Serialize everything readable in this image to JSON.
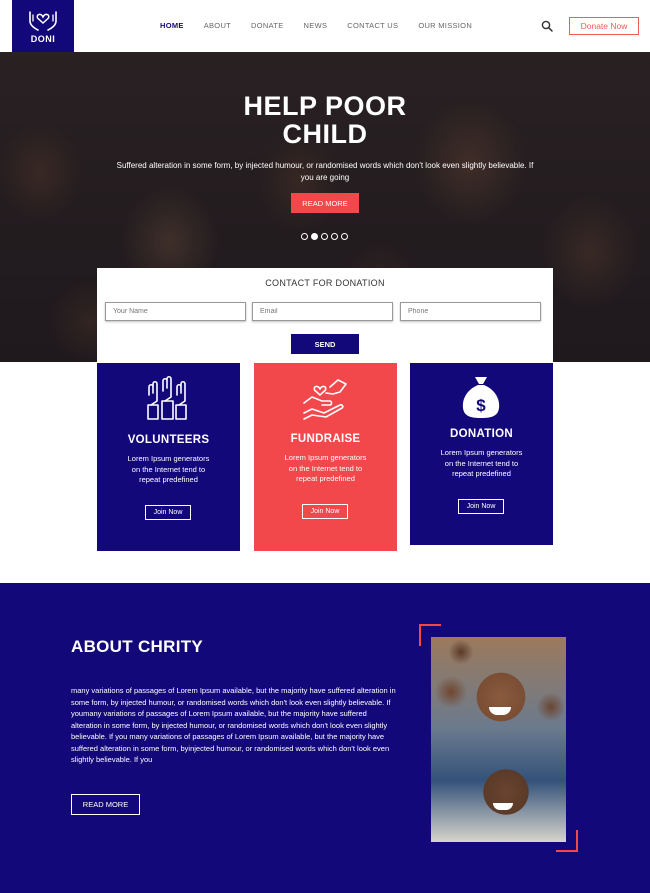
{
  "brand": {
    "name": "DONI"
  },
  "nav": {
    "items": [
      "HOME",
      "ABOUT",
      "DONATE",
      "NEWS",
      "CONTACT US",
      "OUR MISSION"
    ],
    "active": "HOME",
    "donate_label": "Donate Now"
  },
  "hero": {
    "title_line1": "HELP POOR",
    "title_line2": "CHILD",
    "text": "Suffered alteration in some form, by injected humour, or randomised words which don't look even slightly believable. If you are going",
    "button": "READ MORE",
    "slides": 5,
    "active_slide": 2
  },
  "contact": {
    "title": "CONTACT FOR DONATION",
    "name_placeholder": "Your Name",
    "email_placeholder": "Email",
    "phone_placeholder": "Phone",
    "send_label": "SEND"
  },
  "cards": [
    {
      "title": "VOLUNTEERS",
      "text": "Lorem Ipsum generators on the Internet tend to repeat predefined",
      "button": "Join Now",
      "color": "#12087a"
    },
    {
      "title": "FUNDRAISE",
      "text": "Lorem Ipsum generators on the Internet tend to repeat predefined",
      "button": "Join Now",
      "color": "#f2474b"
    },
    {
      "title": "DONATION",
      "text": "Lorem Ipsum generators on the Internet tend to repeat predefined",
      "button": "Join Now",
      "color": "#12087a"
    }
  ],
  "about": {
    "title": "ABOUT CHRITY",
    "text": "many variations of passages of Lorem Ipsum available, but the majority have suffered alteration in some form, by injected humour, or randomised words which don't look even slightly believable. If youmany variations of passages of Lorem Ipsum available, but the majority have suffered alteration in some form, by injected humour, or randomised words which don't look even slightly believable. If you many variations of passages of Lorem Ipsum available, but the majority have suffered alteration in some form, byinjected humour, or randomised words which don't look even slightly believable. If you",
    "button": "READ MORE"
  },
  "colors": {
    "primary": "#12087a",
    "accent": "#f2474b"
  }
}
